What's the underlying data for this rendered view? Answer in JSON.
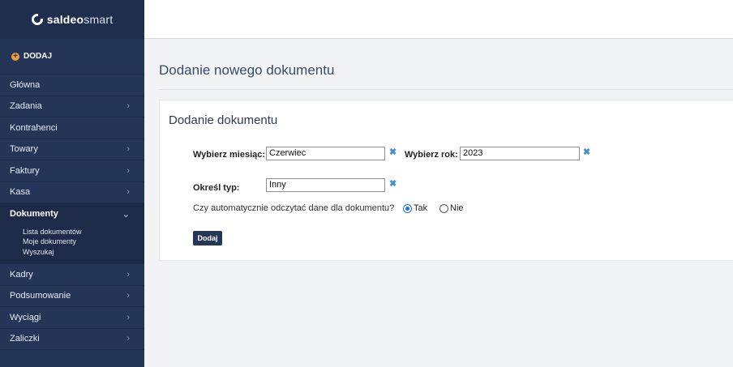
{
  "app": {
    "logo_bold": "saldeo",
    "logo_light": "smart"
  },
  "sidebar": {
    "add_label": "DODAJ",
    "items": [
      {
        "label": "Główna",
        "chevron": false
      },
      {
        "label": "Zadania",
        "chevron": true
      },
      {
        "label": "Kontrahenci",
        "chevron": false
      },
      {
        "label": "Towary",
        "chevron": true
      },
      {
        "label": "Faktury",
        "chevron": true
      },
      {
        "label": "Kasa",
        "chevron": true
      }
    ],
    "active": {
      "label": "Dokumenty",
      "subitems": [
        "Lista dokumentów",
        "Moje dokumenty",
        "Wyszukaj"
      ]
    },
    "items_after": [
      {
        "label": "Kadry",
        "chevron": true
      },
      {
        "label": "Podsumowanie",
        "chevron": true
      },
      {
        "label": "Wyciągi",
        "chevron": true
      },
      {
        "label": "Zaliczki",
        "chevron": true
      }
    ]
  },
  "main": {
    "page_title": "Dodanie nowego dokumentu",
    "card_title": "Dodanie dokumentu",
    "form": {
      "month_label": "Wybierz miesiąc:",
      "month_value": "Czerwiec",
      "year_label": "Wybierz rok:",
      "year_value": "2023",
      "type_label": "Określ typ:",
      "type_value": "Inny",
      "question": "Czy automatycznie odczytać dane dla dokumentu?",
      "radio_yes": "Tak",
      "radio_no": "Nie",
      "selected": "yes",
      "submit_label": "Dodaj"
    }
  }
}
